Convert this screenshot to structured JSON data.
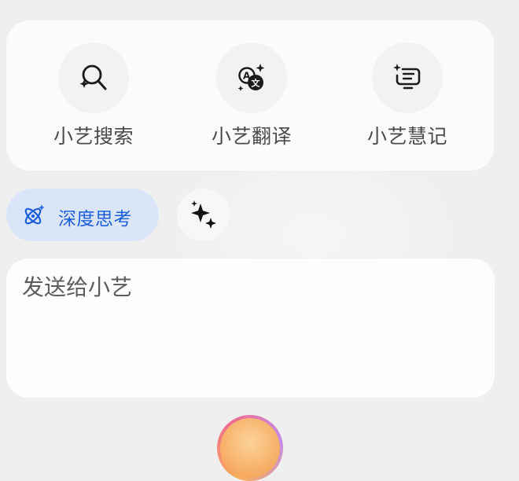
{
  "tools": [
    {
      "label": "小艺搜索",
      "icon": "sparkle-search-icon"
    },
    {
      "label": "小艺翻译",
      "icon": "translate-icon"
    },
    {
      "label": "小艺慧记",
      "icon": "smart-notes-icon"
    }
  ],
  "chips": {
    "deep_think_label": "深度思考",
    "deep_think_icon": "atom-icon",
    "sparkle_icon": "sparkle-icon"
  },
  "composer": {
    "placeholder": "发送给小艺",
    "value": ""
  },
  "colors": {
    "accent": "#1c5fd8",
    "chip_bg": "#dbe5f8",
    "text_secondary": "#4a4a4c"
  }
}
